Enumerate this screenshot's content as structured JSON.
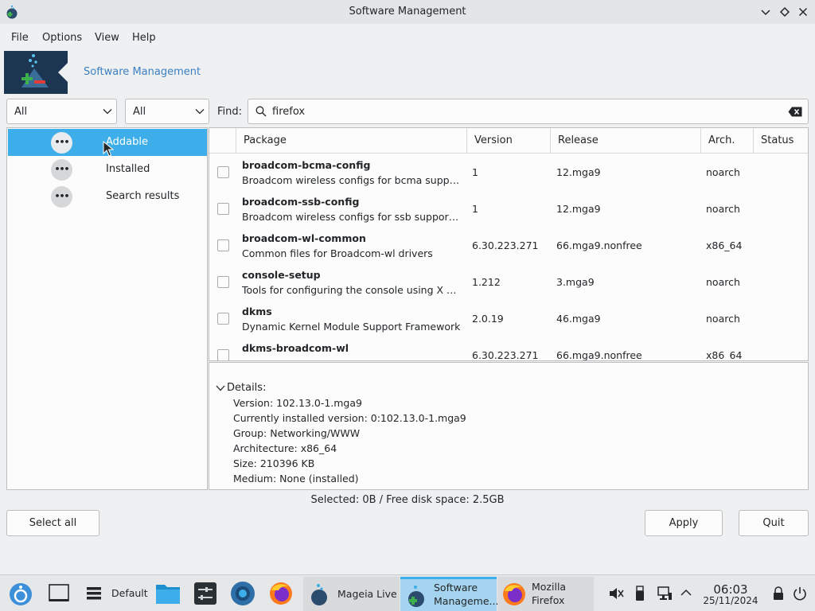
{
  "window": {
    "title": "Software Management",
    "controls": {
      "minimize": "⌄",
      "maximize": "◇",
      "close": "✕"
    }
  },
  "menu": [
    "File",
    "Options",
    "View",
    "Help"
  ],
  "banner": {
    "title": "Software Management"
  },
  "filters": {
    "combo1": "All",
    "combo2": "All",
    "find_label": "Find:",
    "search_value": "firefox"
  },
  "categories": [
    {
      "label": "Addable",
      "icon": "more-icon",
      "selected": true
    },
    {
      "label": "Installed",
      "icon": "more-icon",
      "selected": false
    },
    {
      "label": "Search results",
      "icon": "more-icon",
      "selected": false
    }
  ],
  "table": {
    "headers": [
      "Package",
      "Version",
      "Release",
      "Arch.",
      "Status"
    ],
    "rows": [
      {
        "name": "broadcom-bcma-config",
        "desc": "Broadcom wireless configs for bcma supported devices",
        "version": "1",
        "release": "12.mga9",
        "arch": "noarch"
      },
      {
        "name": "broadcom-ssb-config",
        "desc": "Broadcom wireless configs for ssb supported devices",
        "version": "1",
        "release": "12.mga9",
        "arch": "noarch"
      },
      {
        "name": "broadcom-wl-common",
        "desc": "Common files for Broadcom-wl drivers",
        "version": "6.30.223.271",
        "release": "66.mga9.nonfree",
        "arch": "x86_64"
      },
      {
        "name": "console-setup",
        "desc": "Tools for configuring the console using X Window System key maps",
        "version": "1.212",
        "release": "3.mga9",
        "arch": "noarch"
      },
      {
        "name": "dkms",
        "desc": "Dynamic Kernel Module Support Framework",
        "version": "2.0.19",
        "release": "46.mga9",
        "arch": "noarch"
      },
      {
        "name": "dkms-broadcom-wl",
        "desc": "",
        "version": "6.30.223.271",
        "release": "66.mga9.nonfree",
        "arch": "x86_64"
      }
    ]
  },
  "details": {
    "header": "Details:",
    "lines": [
      "Version: 102.13.0-1.mga9",
      "Currently installed version: 0:102.13.0-1.mga9",
      "Group: Networking/WWW",
      "Architecture: x86_64",
      "Size: 210396 KB",
      "Medium: None (installed)"
    ]
  },
  "status": "Selected: 0B / Free disk space: 2.5GB",
  "buttons": {
    "select_all": "Select all",
    "apply": "Apply",
    "quit": "Quit"
  },
  "taskbar": {
    "desktop_label": "Default",
    "tasks": [
      {
        "label": "Mageia Live",
        "active": false
      },
      {
        "label": "Software Manageme...",
        "active": true
      },
      {
        "label": "Mozilla Firefox",
        "active": false
      }
    ],
    "clock": {
      "time": "06:03",
      "date": "25/11/2024"
    }
  },
  "colors": {
    "accent": "#3daee9",
    "logo_bg": "#1c3550",
    "link": "#3a7fc1"
  }
}
